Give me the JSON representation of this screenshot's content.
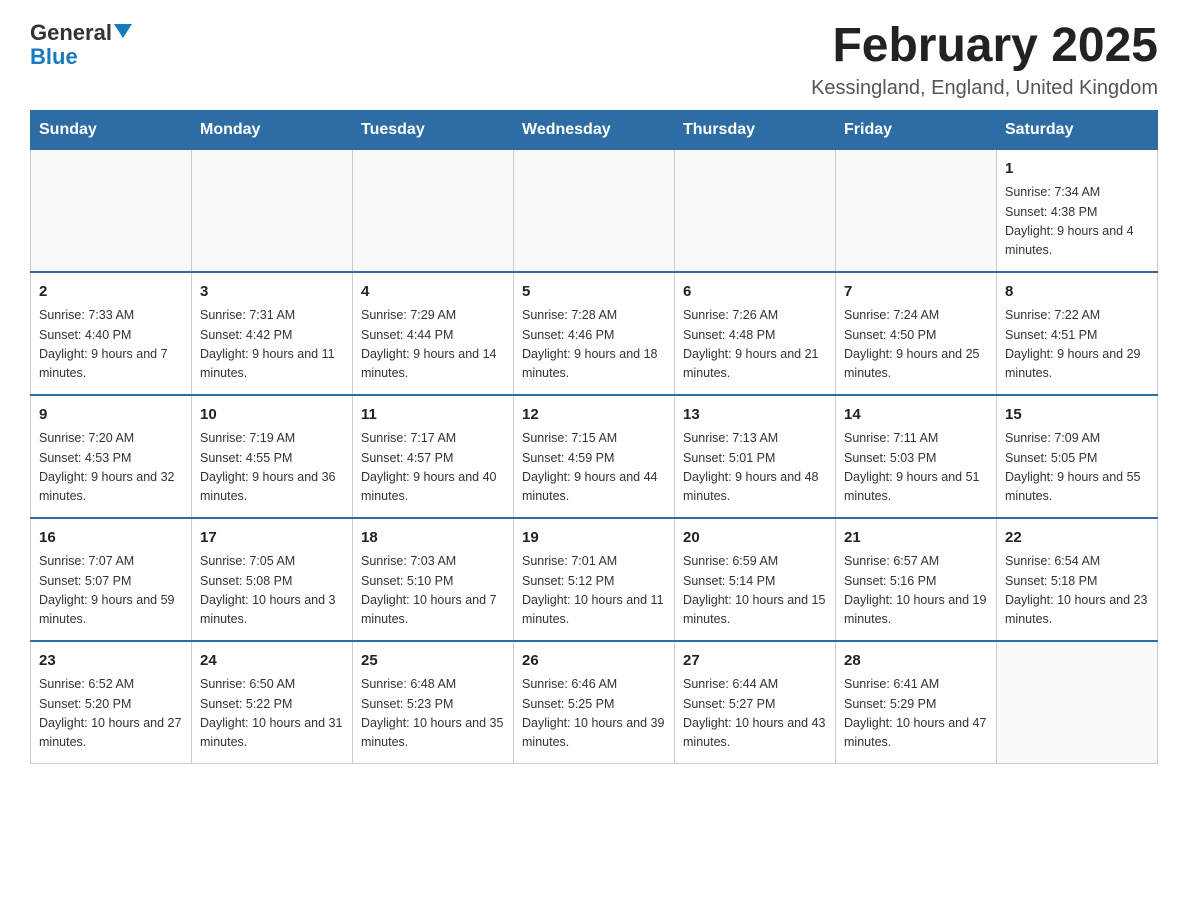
{
  "header": {
    "logo_general": "General",
    "logo_blue": "Blue",
    "month_title": "February 2025",
    "location": "Kessingland, England, United Kingdom"
  },
  "weekdays": [
    "Sunday",
    "Monday",
    "Tuesday",
    "Wednesday",
    "Thursday",
    "Friday",
    "Saturday"
  ],
  "weeks": [
    [
      {
        "day": "",
        "info": ""
      },
      {
        "day": "",
        "info": ""
      },
      {
        "day": "",
        "info": ""
      },
      {
        "day": "",
        "info": ""
      },
      {
        "day": "",
        "info": ""
      },
      {
        "day": "",
        "info": ""
      },
      {
        "day": "1",
        "info": "Sunrise: 7:34 AM\nSunset: 4:38 PM\nDaylight: 9 hours and 4 minutes."
      }
    ],
    [
      {
        "day": "2",
        "info": "Sunrise: 7:33 AM\nSunset: 4:40 PM\nDaylight: 9 hours and 7 minutes."
      },
      {
        "day": "3",
        "info": "Sunrise: 7:31 AM\nSunset: 4:42 PM\nDaylight: 9 hours and 11 minutes."
      },
      {
        "day": "4",
        "info": "Sunrise: 7:29 AM\nSunset: 4:44 PM\nDaylight: 9 hours and 14 minutes."
      },
      {
        "day": "5",
        "info": "Sunrise: 7:28 AM\nSunset: 4:46 PM\nDaylight: 9 hours and 18 minutes."
      },
      {
        "day": "6",
        "info": "Sunrise: 7:26 AM\nSunset: 4:48 PM\nDaylight: 9 hours and 21 minutes."
      },
      {
        "day": "7",
        "info": "Sunrise: 7:24 AM\nSunset: 4:50 PM\nDaylight: 9 hours and 25 minutes."
      },
      {
        "day": "8",
        "info": "Sunrise: 7:22 AM\nSunset: 4:51 PM\nDaylight: 9 hours and 29 minutes."
      }
    ],
    [
      {
        "day": "9",
        "info": "Sunrise: 7:20 AM\nSunset: 4:53 PM\nDaylight: 9 hours and 32 minutes."
      },
      {
        "day": "10",
        "info": "Sunrise: 7:19 AM\nSunset: 4:55 PM\nDaylight: 9 hours and 36 minutes."
      },
      {
        "day": "11",
        "info": "Sunrise: 7:17 AM\nSunset: 4:57 PM\nDaylight: 9 hours and 40 minutes."
      },
      {
        "day": "12",
        "info": "Sunrise: 7:15 AM\nSunset: 4:59 PM\nDaylight: 9 hours and 44 minutes."
      },
      {
        "day": "13",
        "info": "Sunrise: 7:13 AM\nSunset: 5:01 PM\nDaylight: 9 hours and 48 minutes."
      },
      {
        "day": "14",
        "info": "Sunrise: 7:11 AM\nSunset: 5:03 PM\nDaylight: 9 hours and 51 minutes."
      },
      {
        "day": "15",
        "info": "Sunrise: 7:09 AM\nSunset: 5:05 PM\nDaylight: 9 hours and 55 minutes."
      }
    ],
    [
      {
        "day": "16",
        "info": "Sunrise: 7:07 AM\nSunset: 5:07 PM\nDaylight: 9 hours and 59 minutes."
      },
      {
        "day": "17",
        "info": "Sunrise: 7:05 AM\nSunset: 5:08 PM\nDaylight: 10 hours and 3 minutes."
      },
      {
        "day": "18",
        "info": "Sunrise: 7:03 AM\nSunset: 5:10 PM\nDaylight: 10 hours and 7 minutes."
      },
      {
        "day": "19",
        "info": "Sunrise: 7:01 AM\nSunset: 5:12 PM\nDaylight: 10 hours and 11 minutes."
      },
      {
        "day": "20",
        "info": "Sunrise: 6:59 AM\nSunset: 5:14 PM\nDaylight: 10 hours and 15 minutes."
      },
      {
        "day": "21",
        "info": "Sunrise: 6:57 AM\nSunset: 5:16 PM\nDaylight: 10 hours and 19 minutes."
      },
      {
        "day": "22",
        "info": "Sunrise: 6:54 AM\nSunset: 5:18 PM\nDaylight: 10 hours and 23 minutes."
      }
    ],
    [
      {
        "day": "23",
        "info": "Sunrise: 6:52 AM\nSunset: 5:20 PM\nDaylight: 10 hours and 27 minutes."
      },
      {
        "day": "24",
        "info": "Sunrise: 6:50 AM\nSunset: 5:22 PM\nDaylight: 10 hours and 31 minutes."
      },
      {
        "day": "25",
        "info": "Sunrise: 6:48 AM\nSunset: 5:23 PM\nDaylight: 10 hours and 35 minutes."
      },
      {
        "day": "26",
        "info": "Sunrise: 6:46 AM\nSunset: 5:25 PM\nDaylight: 10 hours and 39 minutes."
      },
      {
        "day": "27",
        "info": "Sunrise: 6:44 AM\nSunset: 5:27 PM\nDaylight: 10 hours and 43 minutes."
      },
      {
        "day": "28",
        "info": "Sunrise: 6:41 AM\nSunset: 5:29 PM\nDaylight: 10 hours and 47 minutes."
      },
      {
        "day": "",
        "info": ""
      }
    ]
  ]
}
